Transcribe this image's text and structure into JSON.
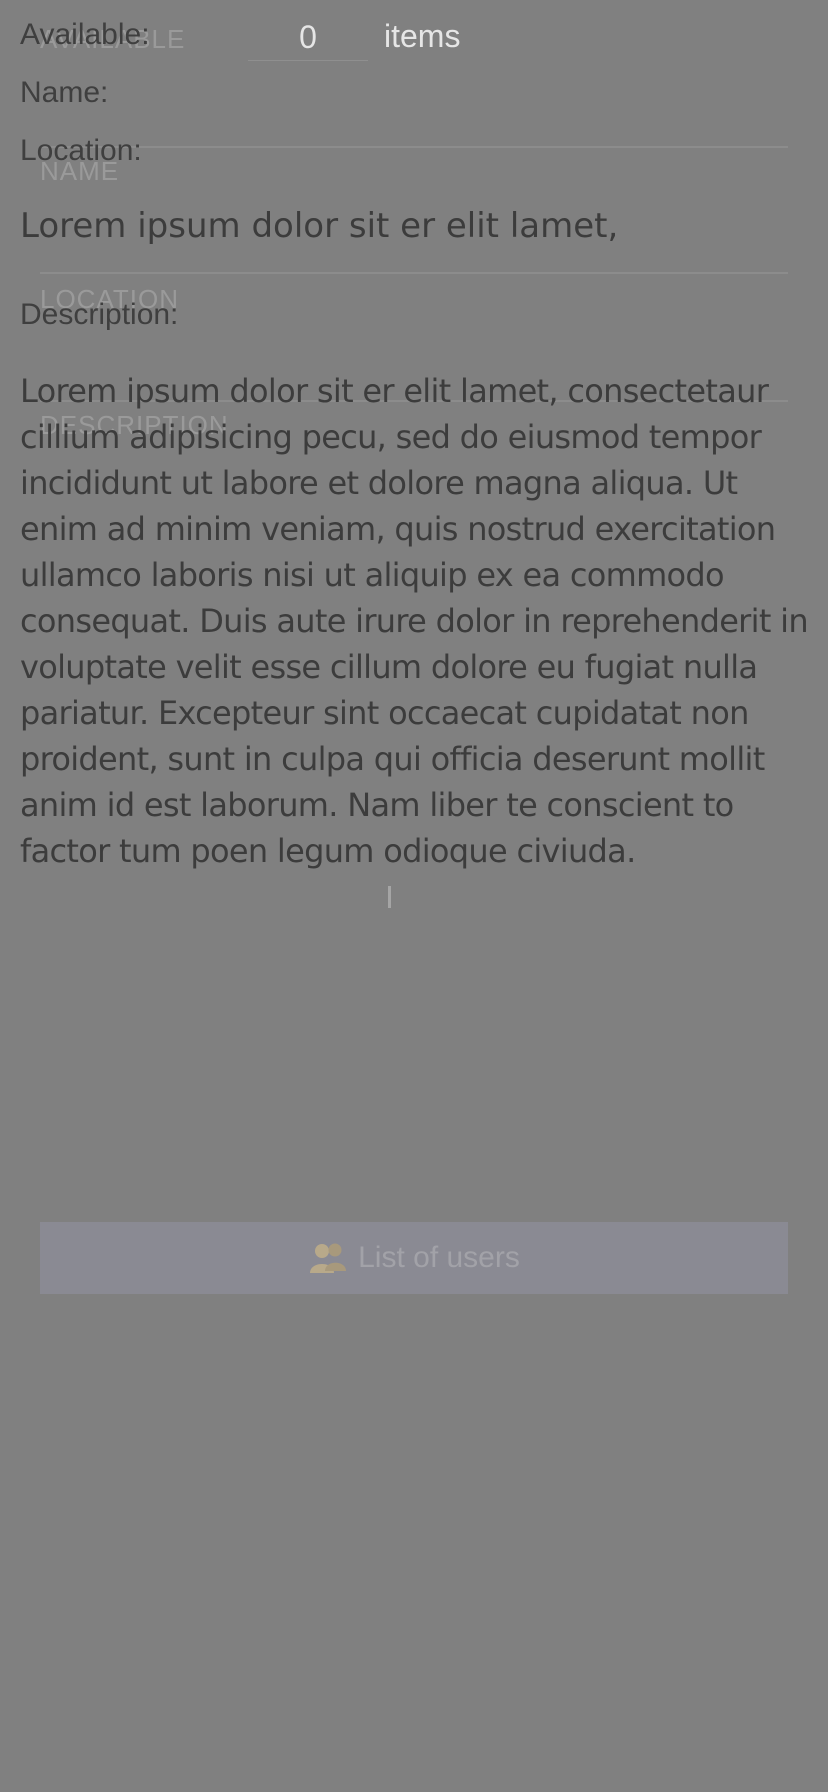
{
  "form": {
    "available_label": "AVAILABLE",
    "available_value": "0",
    "items_unit": "items",
    "name_label": "NAME",
    "location_label": "LOCATION",
    "description_label": "DESCRIPTION",
    "users_button_label": "List of users",
    "users_button_icon": "users-icon"
  },
  "overlay": {
    "available_label": "Available:",
    "name_label": "Name:",
    "location_label": "Location:",
    "location_value": "Lorem ipsum dolor sit er elit lamet,",
    "description_label": "Description:",
    "description_value": "Lorem ipsum dolor sit er elit lamet, consectetaur cillium adipisicing pecu, sed do eiusmod tempor incididunt ut labore et dolore magna aliqua. Ut enim ad minim veniam, quis nostrud exercitation ullamco laboris nisi ut aliquip ex ea commodo consequat. Duis aute irure dolor in reprehenderit in voluptate velit esse cillum dolore eu fugiat nulla pariatur. Excepteur sint occaecat cupidatat non proident, sunt in culpa qui officia deserunt mollit anim id est laborum. Nam liber te conscient to factor tum poen legum odioque civiuda."
  },
  "colors": {
    "background": "#808080",
    "overlay_text": "#3c3c3c",
    "form_text": "#e6e6e6",
    "button_bg": "#8a8a93"
  }
}
